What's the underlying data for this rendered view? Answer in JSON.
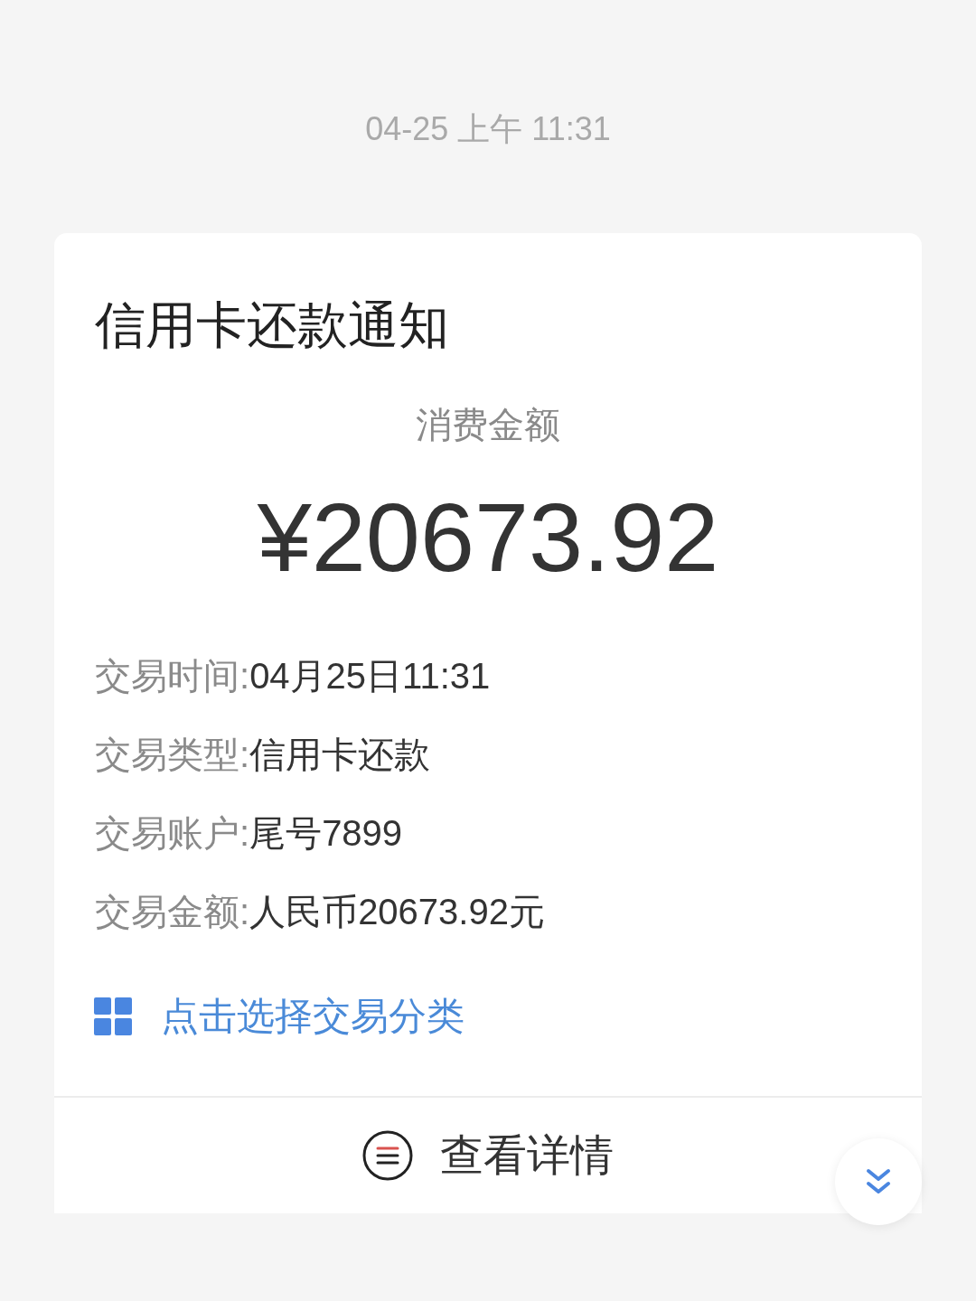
{
  "timestamp": "04-25 上午 11:31",
  "card": {
    "title": "信用卡还款通知",
    "amount_label": "消费金额",
    "amount": "¥20673.92",
    "details": [
      {
        "label": "交易时间:",
        "value": "04月25日11:31"
      },
      {
        "label": "交易类型:",
        "value": "信用卡还款"
      },
      {
        "label": "交易账户:",
        "value": "尾号7899"
      },
      {
        "label": "交易金额:",
        "value": "人民币20673.92元"
      }
    ],
    "category_link": "点击选择交易分类",
    "detail_button": "查看详情"
  }
}
